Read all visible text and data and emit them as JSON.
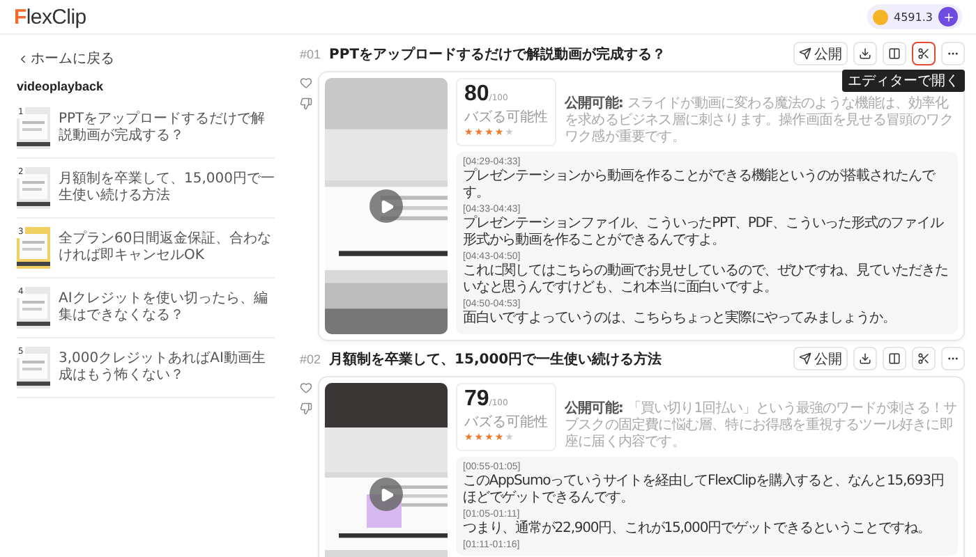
{
  "header": {
    "logo_first": "F",
    "logo_rest": "lexClip",
    "credits": "4591.3"
  },
  "sidebar": {
    "back": "ホームに戻る",
    "title": "videoplayback",
    "items": [
      {
        "number": "1",
        "title": "PPTをアップロードするだけで解説動画が完成する？",
        "selected": false
      },
      {
        "number": "2",
        "title": "月額制を卒業して、15,000円で一生使い続ける方法",
        "selected": false
      },
      {
        "number": "3",
        "title": "全プラン60日間返金保証、合わなければ即キャンセルOK",
        "selected": false
      },
      {
        "number": "4",
        "title": "AIクレジットを使い切ったら、編集はできなくなる？",
        "selected": false
      },
      {
        "number": "5",
        "title": "3,000クレジットあればAI動画生成はもう怖くない？",
        "selected": false
      }
    ]
  },
  "clips": [
    {
      "index": "#01",
      "title": "PPTをアップロードするだけで解説動画が完成する？",
      "actions": [
        {
          "kind": "publish",
          "label": "公開",
          "highlighted": false
        },
        {
          "kind": "download",
          "highlighted": false
        },
        {
          "kind": "split",
          "highlighted": false
        },
        {
          "kind": "edit",
          "highlighted": true,
          "tooltip": "エディターで開く"
        },
        {
          "kind": "more",
          "highlighted": false
        }
      ],
      "score": "80",
      "score_max": "/100",
      "score_label": "バズる可能性",
      "stars": 4,
      "summary": "**公開可能:** スライドが動画に変わる魔法のような機能は、効率化を求めるビジネス層に刺さります。操作画面を見せる冒頭のワクワク感が重要です。",
      "transcript": [
        {
          "time": "[04:29-04:33]",
          "text": "プレゼンテーションから動画を作ることができる機能というのが搭載されたんです。"
        },
        {
          "time": "[04:33-04:43]",
          "text": "プレゼンテーションファイル、こういったPPT、PDF、こういった形式のファイル形式から動画を作ることができるんですよ。"
        },
        {
          "time": "[04:43-04:50]",
          "text": "これに関してはこちらの動画でお見せしているので、ぜひですね、見ていただきたいなと思うんですけども、これ本当に面白いですよ。"
        },
        {
          "time": "[04:50-04:53]",
          "text": "面白いですよっていうのは、こちらちょっと実際にやってみましょうか。"
        }
      ]
    },
    {
      "index": "#02",
      "title": "月額制を卒業して、15,000円で一生使い続ける方法",
      "actions": [
        {
          "kind": "publish",
          "label": "公開",
          "highlighted": false
        },
        {
          "kind": "download",
          "highlighted": false
        },
        {
          "kind": "split",
          "highlighted": false
        },
        {
          "kind": "edit",
          "highlighted": false
        },
        {
          "kind": "more",
          "highlighted": false
        }
      ],
      "score": "79",
      "score_max": "/100",
      "score_label": "バズる可能性",
      "stars": 4,
      "summary": "**公開可能:** 「買い切り1回払い」という最強のワードが刺さる！サブスクの固定費に悩む層、特にお得感を重視するツール好きに即座に届く内容です。",
      "transcript": [
        {
          "time": "[00:55-01:05]",
          "text": "このAppSumoっていうサイトを経由してFlexClipを購入すると、なんと15,693円ほどでゲットできるんです。"
        },
        {
          "time": "[01:05-01:11]",
          "text": "つまり、通常が22,900円、これが15,000円でゲットできるということですね。"
        },
        {
          "time": "[01:11-01:16]"
        }
      ]
    }
  ]
}
